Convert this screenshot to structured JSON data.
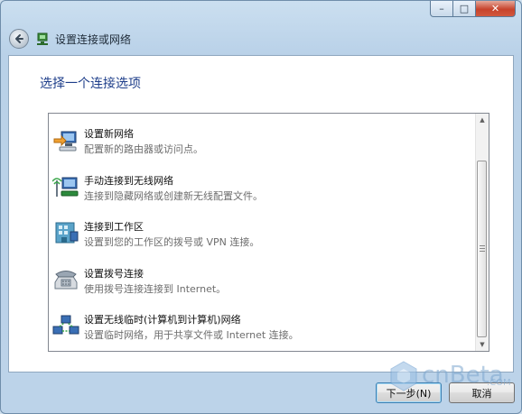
{
  "window": {
    "title": "设置连接或网络",
    "caption_buttons": {
      "minimize": "–",
      "maximize": "□",
      "close": "✕"
    }
  },
  "header": {
    "heading": "选择一个连接选项"
  },
  "options": [
    {
      "title": "设置新网络",
      "description": "配置新的路由器或访问点。",
      "icon": "new-network-icon"
    },
    {
      "title": "手动连接到无线网络",
      "description": "连接到隐藏网络或创建新无线配置文件。",
      "icon": "wireless-network-icon"
    },
    {
      "title": "连接到工作区",
      "description": "设置到您的工作区的拨号或 VPN 连接。",
      "icon": "workplace-icon"
    },
    {
      "title": "设置拨号连接",
      "description": "使用拨号连接连接到 Internet。",
      "icon": "dialup-phone-icon"
    },
    {
      "title": "设置无线临时(计算机到计算机)网络",
      "description": "设置临时网络，用于共享文件或 Internet 连接。",
      "icon": "adhoc-network-icon"
    }
  ],
  "footer": {
    "next_label": "下一步(N)",
    "cancel_label": "取消"
  },
  "watermark": {
    "text": "cnBeta",
    "suffix": ".COM"
  },
  "colors": {
    "heading": "#1e3e8a",
    "close_button": "#c7432c",
    "window_frame": "#bcd3e9"
  }
}
